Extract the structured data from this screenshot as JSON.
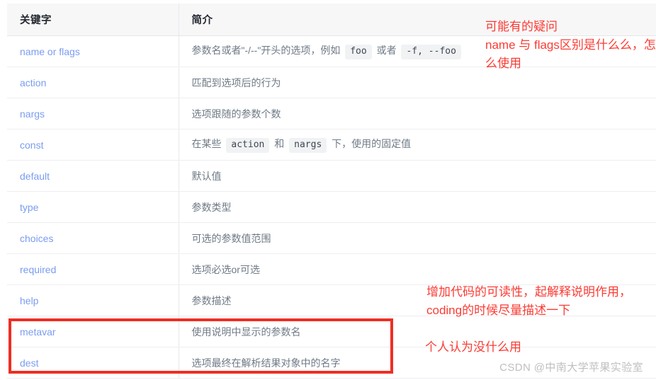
{
  "table": {
    "headers": [
      "关键字",
      "简介"
    ],
    "rows": [
      {
        "keyword": "name or flags",
        "desc_parts": [
          {
            "type": "text",
            "text": "参数名或者\"-/--\"开头的选项，例如 "
          },
          {
            "type": "code",
            "text": "foo"
          },
          {
            "type": "text",
            "text": " 或者 "
          },
          {
            "type": "code",
            "text": "-f, --foo"
          }
        ],
        "desc_plain": "参数名或者\"-/--\"开头的选项，例如 foo 或者 -f, --foo"
      },
      {
        "keyword": "action",
        "desc_parts": [
          {
            "type": "text",
            "text": "匹配到选项后的行为"
          }
        ],
        "desc_plain": "匹配到选项后的行为"
      },
      {
        "keyword": "nargs",
        "desc_parts": [
          {
            "type": "text",
            "text": "选项跟随的参数个数"
          }
        ],
        "desc_plain": "选项跟随的参数个数"
      },
      {
        "keyword": "const",
        "desc_parts": [
          {
            "type": "text",
            "text": "在某些 "
          },
          {
            "type": "code",
            "text": "action"
          },
          {
            "type": "text",
            "text": " 和 "
          },
          {
            "type": "code",
            "text": "nargs"
          },
          {
            "type": "text",
            "text": " 下，使用的固定值"
          }
        ],
        "desc_plain": "在某些 action 和 nargs 下，使用的固定值"
      },
      {
        "keyword": "default",
        "desc_parts": [
          {
            "type": "text",
            "text": "默认值"
          }
        ],
        "desc_plain": "默认值"
      },
      {
        "keyword": "type",
        "desc_parts": [
          {
            "type": "text",
            "text": "参数类型"
          }
        ],
        "desc_plain": "参数类型"
      },
      {
        "keyword": "choices",
        "desc_parts": [
          {
            "type": "text",
            "text": "可选的参数值范围"
          }
        ],
        "desc_plain": "可选的参数值范围"
      },
      {
        "keyword": "required",
        "desc_parts": [
          {
            "type": "text",
            "text": "选项必选or可选"
          }
        ],
        "desc_plain": "选项必选or可选"
      },
      {
        "keyword": "help",
        "desc_parts": [
          {
            "type": "text",
            "text": "参数描述"
          }
        ],
        "desc_plain": "参数描述"
      },
      {
        "keyword": "metavar",
        "desc_parts": [
          {
            "type": "text",
            "text": "使用说明中显示的参数名"
          }
        ],
        "desc_plain": "使用说明中显示的参数名"
      },
      {
        "keyword": "dest",
        "desc_parts": [
          {
            "type": "text",
            "text": "选项最终在解析结果对象中的名字"
          }
        ],
        "desc_plain": "选项最终在解析结果对象中的名字"
      }
    ]
  },
  "annotations": {
    "top": "可能有的疑问\nname 与 flags区别是什么么，怎么使用",
    "middle": "增加代码的可读性，起解释说明作用，coding的时候尽量描述一下",
    "bottom": "个人认为没什么用"
  },
  "highlight": {
    "color": "#ee2e24",
    "rows": [
      "metavar",
      "dest"
    ]
  },
  "watermark": "CSDN @中南大学苹果实验室",
  "colors": {
    "keyword_link": "#7a9cf0",
    "description_text": "#6f7a86",
    "header_bg": "#f7f7f8",
    "annotation_red": "#fb3b33",
    "code_chip_bg": "#f1f2f4"
  }
}
